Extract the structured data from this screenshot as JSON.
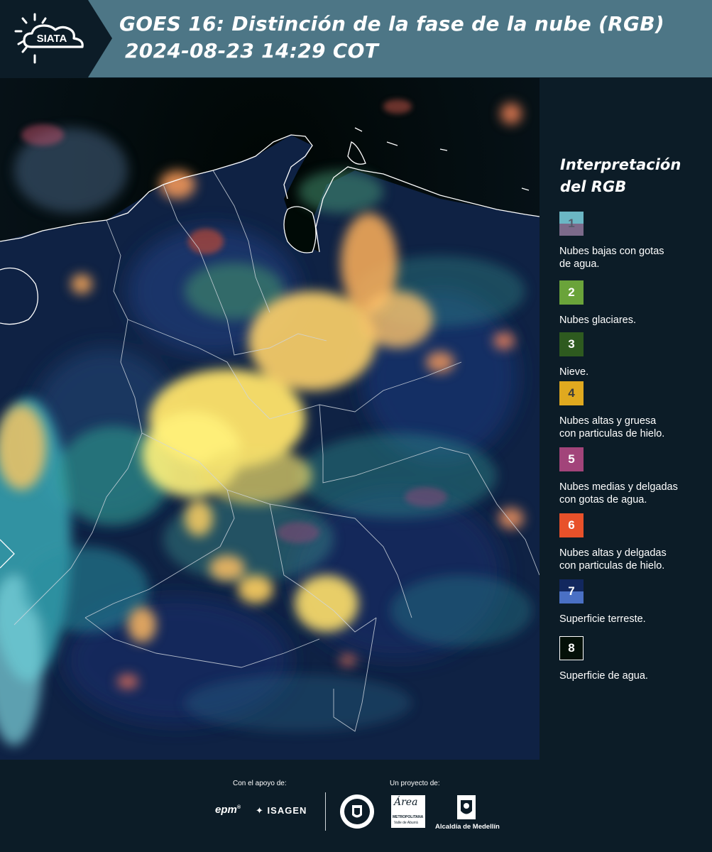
{
  "header": {
    "logo_text": "SIATA",
    "title": "GOES 16: Distinción de la fase de la nube (RGB)",
    "datetime": "2024-08-23 14:29 COT"
  },
  "legend": {
    "title_line1": "Interpretación",
    "title_line2": "del RGB",
    "items": [
      {
        "number": "1",
        "label_lines": [
          "Nubes bajas con gotas",
          "de agua."
        ],
        "colors": [
          "#6bb6c4",
          "#7c6a8a"
        ]
      },
      {
        "number": "2",
        "label_lines": [
          "Nubes glaciares."
        ],
        "colors": [
          "#6aa33a"
        ]
      },
      {
        "number": "3",
        "label_lines": [
          "Nieve."
        ],
        "colors": [
          "#2e5a1f"
        ]
      },
      {
        "number": "4",
        "label_lines": [
          "Nubes altas y gruesa",
          "con particulas de hielo."
        ],
        "colors": [
          "#e0a91f"
        ]
      },
      {
        "number": "5",
        "label_lines": [
          "Nubes medias y delgadas",
          "con gotas de agua."
        ],
        "colors": [
          "#a2447a"
        ]
      },
      {
        "number": "6",
        "label_lines": [
          "Nubes altas y delgadas",
          "con particulas de hielo."
        ],
        "colors": [
          "#e8512a"
        ]
      },
      {
        "number": "7",
        "label_lines": [
          "Superficie terreste."
        ],
        "colors": [
          "#12275e",
          "#4a70c4"
        ]
      },
      {
        "number": "8",
        "label_lines": [
          "Superficie de agua."
        ],
        "colors": [
          "#041008"
        ]
      }
    ]
  },
  "footer": {
    "support_label": "Con el apoyo de:",
    "project_label": "Un proyecto de:",
    "sponsor_1": "epm",
    "sponsor_2": "ISAGEN",
    "area_logo_text": "Área",
    "area_logo_sub": "METROPOLITANA",
    "area_logo_sub2": "Valle de Aburrá",
    "alcaldia": "Alcaldía de Medellín"
  }
}
